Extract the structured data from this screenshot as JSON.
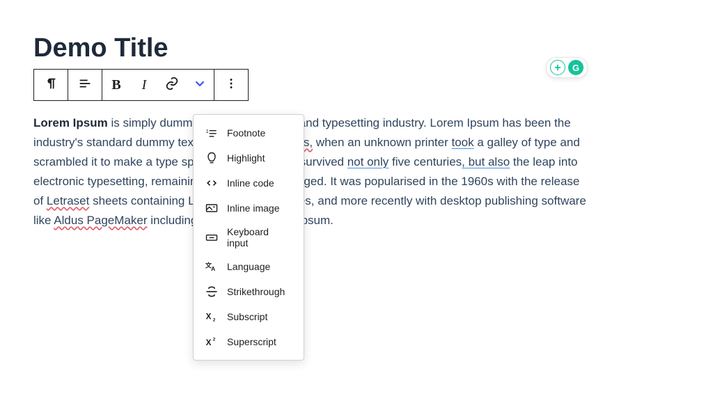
{
  "page": {
    "title": "Demo Title"
  },
  "toolbar": {
    "paragraph_tooltip": "Paragraph",
    "align_tooltip": "Align",
    "bold_label": "B",
    "italic_label": "I",
    "link_tooltip": "Link",
    "more_rich_tooltip": "More rich text controls",
    "options_tooltip": "Options"
  },
  "dropdown": {
    "items": [
      {
        "id": "footnote",
        "label": "Footnote"
      },
      {
        "id": "highlight",
        "label": "Highlight"
      },
      {
        "id": "inline-code",
        "label": "Inline code"
      },
      {
        "id": "inline-image",
        "label": "Inline image"
      },
      {
        "id": "keyboard",
        "label": "Keyboard input"
      },
      {
        "id": "language",
        "label": "Language"
      },
      {
        "id": "strikethrough",
        "label": "Strikethrough"
      },
      {
        "id": "subscript",
        "label": "Subscript"
      },
      {
        "id": "superscript",
        "label": "Superscript"
      }
    ]
  },
  "body": {
    "lead_strong": "Lorem Ipsum",
    "seg1": " is simply dummy text of the printing and typesetting industry. Lorem Ipsum has been the industry's standard dummy text ever since the ",
    "seg2_1500s": "1500s,",
    "seg3": " when an unknown printer ",
    "seg4_took": "took",
    "seg5": " a galley of type and scrambled it to make a type specimen book. It has survived ",
    "seg6_notonly": "not only",
    "seg7": " five centuries",
    "seg8_butalso": ", but also",
    "seg9": " the leap into electronic typesetting, remaining essentially unchanged. It was popularised in the 1960s with the release of ",
    "seg10_letraset": "Letraset",
    "seg11": " sheets containing Lorem Ipsum passages, and more recently with desktop publishing software like ",
    "seg12_aldus": "Aldus PageMaker",
    "seg13": " including versions of Lorem Ipsum."
  },
  "grammarly": {
    "badge_label": "G"
  }
}
